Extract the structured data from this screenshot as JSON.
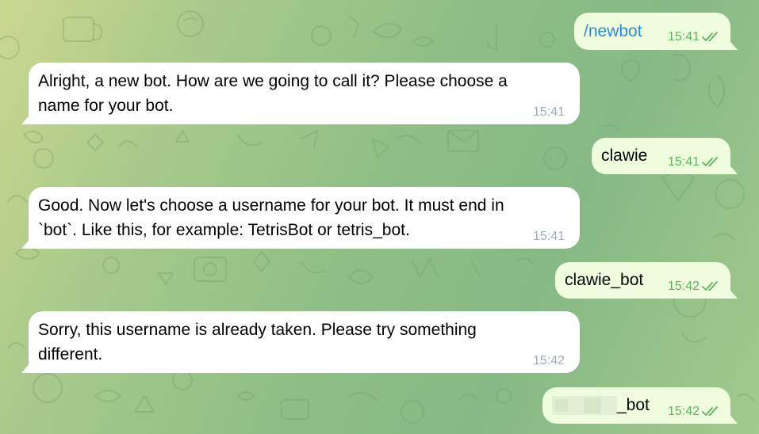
{
  "messages": [
    {
      "id": "m1",
      "direction": "out",
      "text": "/newbot",
      "time": "15:41",
      "is_command": true,
      "status": "read"
    },
    {
      "id": "m2",
      "direction": "in",
      "text": "Alright, a new bot. How are we going to call it? Please choose a\nname for your bot.",
      "time": "15:41"
    },
    {
      "id": "m3",
      "direction": "out",
      "text": "clawie",
      "time": "15:41",
      "status": "read"
    },
    {
      "id": "m4",
      "direction": "in",
      "text": "Good. Now let's choose a username for your bot. It must end in\n`bot`. Like this, for example: TetrisBot or tetris_bot.",
      "time": "15:41"
    },
    {
      "id": "m5",
      "direction": "out",
      "text": "clawie_bot",
      "time": "15:42",
      "status": "read"
    },
    {
      "id": "m6",
      "direction": "in",
      "text": "Sorry, this username is already taken. Please try something\ndifferent.",
      "time": "15:42"
    },
    {
      "id": "m7",
      "direction": "out",
      "text": "_bot",
      "time": "15:42",
      "status": "read",
      "redacted_prefix": true
    }
  ],
  "colors": {
    "incoming_bubble": "#ffffff",
    "outgoing_bubble": "#effdde",
    "command_link": "#2e8ad9",
    "outgoing_meta": "#5fb35c",
    "incoming_meta": "#a0acb6",
    "background_top_left": "#cbd88f",
    "background_main": "#8fbf86"
  },
  "icons": {
    "read_receipt": "double-check-icon"
  }
}
